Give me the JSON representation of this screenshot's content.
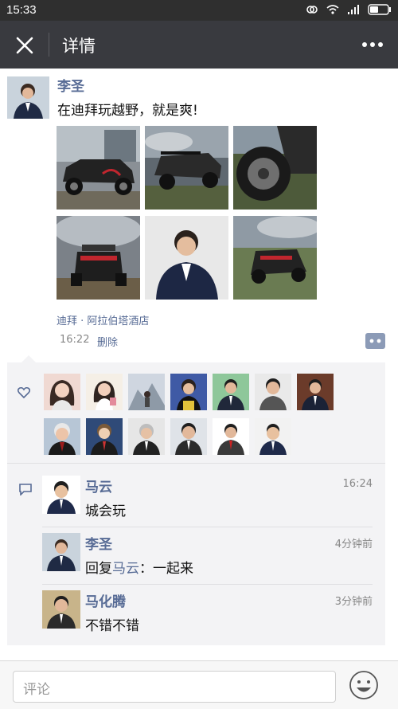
{
  "status_bar": {
    "time": "15:33"
  },
  "nav": {
    "title": "详情"
  },
  "post": {
    "author": "李圣",
    "text": "在迪拜玩越野，就是爽!",
    "location": "迪拜 · 阿拉伯塔酒店",
    "time": "16:22",
    "delete_label": "删除"
  },
  "likes": {
    "count_shown": 13
  },
  "comments": [
    {
      "name": "马云",
      "time": "16:24",
      "text": "城会玩"
    },
    {
      "name": "李圣",
      "time": "4分钟前",
      "reply_prefix": "回复",
      "reply_to": "马云",
      "reply_sep": "：",
      "text": "一起来"
    },
    {
      "name": "马化腾",
      "time": "3分钟前",
      "text": "不错不错"
    }
  ],
  "composer": {
    "placeholder": "评论"
  },
  "colors": {
    "link": "#576b95",
    "navbar": "#393a3f",
    "panel": "#f3f3f5"
  }
}
